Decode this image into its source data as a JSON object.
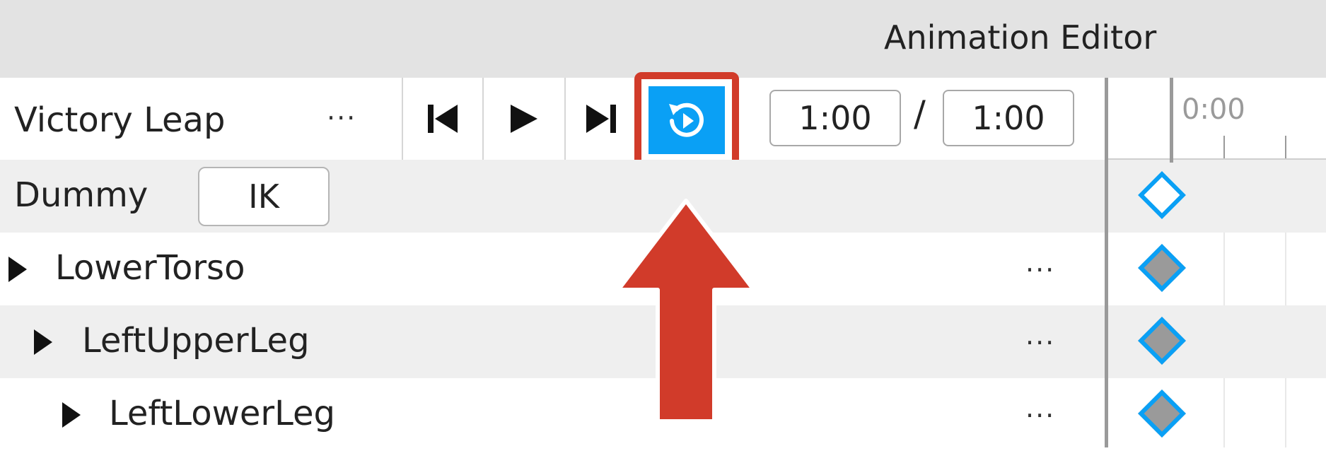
{
  "window": {
    "title": "Animation Editor"
  },
  "toolbar": {
    "animation_name": "Victory Leap",
    "more_label": "···",
    "current_time": "1:00",
    "separator": "/",
    "total_time": "1:00"
  },
  "timeline": {
    "start_label": "0:00"
  },
  "rig": {
    "name": "Dummy",
    "ik_label": "IK"
  },
  "tracks": [
    {
      "name": "LowerTorso",
      "more": "···"
    },
    {
      "name": "LeftUpperLeg",
      "more": "···"
    },
    {
      "name": "LeftLowerLeg",
      "more": "···"
    }
  ],
  "colors": {
    "accent": "#0aa0f5",
    "highlight": "#d13b2a",
    "title_bar": "#e3e3e3"
  },
  "icons": {
    "prev": "skip-to-start-icon",
    "play": "play-icon",
    "next": "skip-to-end-icon",
    "loop": "loop-icon",
    "arrow": "annotation-arrow-icon"
  }
}
